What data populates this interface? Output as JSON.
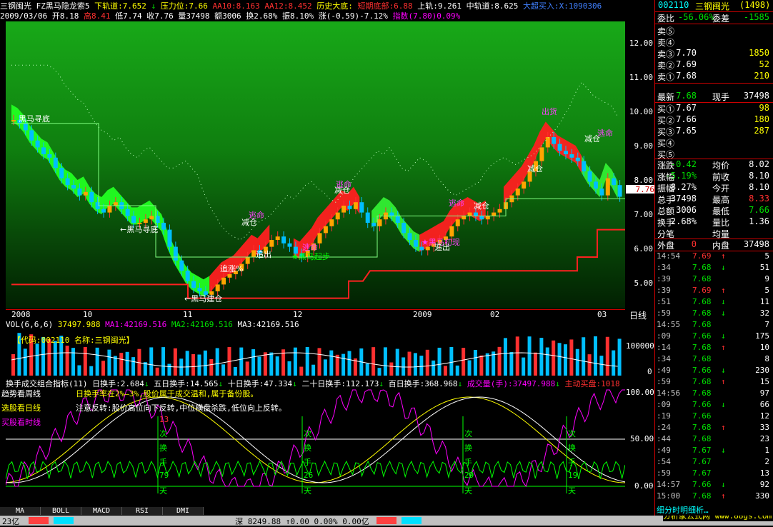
{
  "top": {
    "stock_name": "三钢闽光",
    "formula": "FZ黑马隐龙索5",
    "down_track": "下轨道:7.652",
    "pressure": "压力位:7.66",
    "aa10": "AA10:8.163",
    "aa12": "AA12:8.452",
    "history_bottom": "历史大底:",
    "short_bottom": "短期底部:6.88",
    "up_track": "上轨:9.261",
    "mid_track": "中轨道:8.625",
    "big_buy": "大超买入:X:1090306"
  },
  "info": {
    "date": "2009/03/06",
    "open": "开8.18",
    "high": "高8.41",
    "low": "低7.74",
    "close": "收7.76",
    "vol": "量37498",
    "amt": "额3006",
    "turn": "换2.68%",
    "amp": "振8.10%",
    "chg": "涨(-0.59)-7.12%",
    "index": "指数(7.80)0.09%"
  },
  "chart": {
    "price_axis": [
      "12.00",
      "11.00",
      "10.00",
      "9.00",
      "8.00",
      "7.00",
      "6.00",
      "5.00"
    ],
    "current_price": "7.76",
    "dates": [
      "2008",
      "10",
      "11",
      "12",
      "2009",
      "02",
      "03"
    ],
    "period": "日线",
    "annotations": [
      {
        "text": "黑马寻底",
        "color": "#ffffff"
      },
      {
        "text": "←黑马寻底",
        "color": "#ffffff"
      },
      {
        "text": "←黑马建仓",
        "color": "#ffffff"
      },
      {
        "text": "减仓",
        "color": "#ffffff"
      },
      {
        "text": "逃命",
        "color": "#ff40ff"
      },
      {
        "text": "减仓",
        "color": "#ffffff"
      },
      {
        "text": "逃命",
        "color": "#ff40ff"
      },
      {
        "text": "★黑马起步",
        "color": "#00ff00"
      },
      {
        "text": "追涨%",
        "color": "#ffffff"
      },
      {
        "text": "追出",
        "color": "#ffffff"
      },
      {
        "text": "逃命",
        "color": "#ff40ff"
      },
      {
        "text": "减仓",
        "color": "#ffffff"
      },
      {
        "text": "★黑马初现",
        "color": "#ff40ff"
      },
      {
        "text": "追出",
        "color": "#ffffff"
      },
      {
        "text": "逃命",
        "color": "#ff40ff"
      },
      {
        "text": "出货",
        "color": "#ff40ff"
      },
      {
        "text": "减仓",
        "color": "#ffffff"
      },
      {
        "text": "减仓",
        "color": "#ffffff"
      },
      {
        "text": "逃命",
        "color": "#ff40ff"
      }
    ]
  },
  "volume": {
    "header": "VOL(6,6,6)",
    "vol": "37497.988",
    "ma1": "MA1:42169.516",
    "ma2": "MA2:42169.516",
    "ma3": "MA3:42169.516",
    "code_label": "【代码:002110  名称:三钢闽光】",
    "axis": [
      "100000",
      "0"
    ]
  },
  "indicator": {
    "name": "换手成交组合指标(11)",
    "d1": "日换手:2.684",
    "d5": "五日换手:14.565",
    "d10": "十日换手:47.334",
    "d20": "二十日换手:112.173",
    "d100": "百日换手:368.968",
    "volh": "成交量(手):37497.988",
    "buy": "主动买盘:1018",
    "line1": "趋势看周线",
    "line2": "选股看日线",
    "line3": "买股看时线",
    "note1": "日换手率在2%–3%,股价属于成交温和,属于备份股。",
    "note2": "注意反转:股价高位向下反转,中位横盘杀跌,低位向上反转。",
    "axis": [
      "100.00",
      "50.00",
      "0.00"
    ],
    "vtexts": [
      {
        "num": "13",
        "chars": [
          "次",
          "换",
          "手",
          "79",
          "天"
        ]
      },
      {
        "num": "",
        "chars": [
          "次",
          "换",
          "手",
          "26",
          "天"
        ]
      },
      {
        "num": "",
        "chars": [
          "次",
          "换",
          "手",
          "29",
          "天"
        ]
      },
      {
        "num": "",
        "chars": [
          "次",
          "换",
          "手",
          "19",
          "天"
        ]
      }
    ]
  },
  "tabs": [
    "MA",
    "BOLL",
    "MACD",
    "RSI",
    "DMI"
  ],
  "status": {
    "left": "23亿",
    "mid": "深 8249.88 ↑0.00 0.00% 0.00亿",
    "brand": "分析家公式网 www.88gs.com"
  },
  "side": {
    "code": "002110",
    "name": "三钢闽光",
    "num": "(1498)",
    "weibi_label": "委比",
    "weibi": "-56.06%",
    "weicha_label": "委差",
    "weicha": "-1585",
    "sells": [
      {
        "label": "卖⑤",
        "price": "",
        "qty": ""
      },
      {
        "label": "卖④",
        "price": "",
        "qty": ""
      },
      {
        "label": "卖③",
        "price": "7.70",
        "qty": "1850"
      },
      {
        "label": "卖②",
        "price": "7.69",
        "qty": "52"
      },
      {
        "label": "卖①",
        "price": "7.68",
        "qty": "210"
      }
    ],
    "latest_label": "最新",
    "latest": "7.68",
    "xianshou_label": "现手",
    "xianshou": "37498",
    "buys": [
      {
        "label": "买①",
        "price": "7.67",
        "qty": "98"
      },
      {
        "label": "买②",
        "price": "7.66",
        "qty": "180"
      },
      {
        "label": "买③",
        "price": "7.65",
        "qty": "287"
      },
      {
        "label": "买④",
        "price": "",
        "qty": ""
      },
      {
        "label": "买⑤",
        "price": "",
        "qty": ""
      }
    ],
    "stats": [
      {
        "l1": "涨跌",
        "v1": "-0.42",
        "c1": "green",
        "l2": "均价",
        "v2": "8.02",
        "c2": "white"
      },
      {
        "l1": "涨幅",
        "v1": "-5.19%",
        "c1": "green",
        "l2": "前收",
        "v2": "8.10",
        "c2": "white"
      },
      {
        "l1": "振幅",
        "v1": "8.27%",
        "c1": "white",
        "l2": "今开",
        "v2": "8.10",
        "c2": "white"
      },
      {
        "l1": "总手",
        "v1": "37498",
        "c1": "white",
        "l2": "最高",
        "v2": "8.33",
        "c2": "red"
      },
      {
        "l1": "总额",
        "v1": "3006",
        "c1": "white",
        "l2": "最低",
        "v2": "7.66",
        "c2": "green"
      },
      {
        "l1": "换手",
        "v1": "2.68%",
        "c1": "white",
        "l2": "量比",
        "v2": "1.36",
        "c2": "white"
      },
      {
        "l1": "分笔",
        "v1": "",
        "c1": "white",
        "l2": "均量",
        "v2": "",
        "c2": "white"
      }
    ],
    "wp_label": "外盘",
    "wp": "0",
    "np_label": "内盘",
    "np": "37498",
    "ticks": [
      {
        "t": "14:54",
        "p": "7.69",
        "a": "↑",
        "q": "5",
        "pc": "red",
        "ac": "red",
        "qc": "white"
      },
      {
        "t": ":34",
        "p": "7.68",
        "a": "↓",
        "q": "51",
        "pc": "green",
        "ac": "green",
        "qc": "white"
      },
      {
        "t": ":39",
        "p": "7.68",
        "a": "",
        "q": "9",
        "pc": "green",
        "ac": "green",
        "qc": "white"
      },
      {
        "t": ":39",
        "p": "7.69",
        "a": "↑",
        "q": "5",
        "pc": "red",
        "ac": "red",
        "qc": "white"
      },
      {
        "t": ":51",
        "p": "7.68",
        "a": "↓",
        "q": "11",
        "pc": "green",
        "ac": "green",
        "qc": "white"
      },
      {
        "t": ":59",
        "p": "7.68",
        "a": "↓",
        "q": "32",
        "pc": "green",
        "ac": "green",
        "qc": "white"
      },
      {
        "t": "14:55",
        "p": "7.68",
        "a": "",
        "q": "7",
        "pc": "green",
        "ac": "green",
        "qc": "white"
      },
      {
        "t": ":09",
        "p": "7.66",
        "a": "↓",
        "q": "175",
        "pc": "green",
        "ac": "green",
        "qc": "white"
      },
      {
        "t": ":14",
        "p": "7.68",
        "a": "↑",
        "q": "10",
        "pc": "green",
        "ac": "red",
        "qc": "white"
      },
      {
        "t": ":34",
        "p": "7.68",
        "a": "",
        "q": "8",
        "pc": "green",
        "ac": "green",
        "qc": "white"
      },
      {
        "t": ":49",
        "p": "7.66",
        "a": "↓",
        "q": "230",
        "pc": "green",
        "ac": "green",
        "qc": "white"
      },
      {
        "t": ":59",
        "p": "7.68",
        "a": "↑",
        "q": "15",
        "pc": "green",
        "ac": "red",
        "qc": "white"
      },
      {
        "t": "14:56",
        "p": "7.68",
        "a": "",
        "q": "97",
        "pc": "green",
        "ac": "green",
        "qc": "white"
      },
      {
        "t": ":09",
        "p": "7.66",
        "a": "↓",
        "q": "66",
        "pc": "green",
        "ac": "green",
        "qc": "white"
      },
      {
        "t": ":19",
        "p": "7.66",
        "a": "",
        "q": "12",
        "pc": "green",
        "ac": "green",
        "qc": "white"
      },
      {
        "t": ":24",
        "p": "7.68",
        "a": "↑",
        "q": "33",
        "pc": "green",
        "ac": "red",
        "qc": "white"
      },
      {
        "t": ":44",
        "p": "7.68",
        "a": "",
        "q": "23",
        "pc": "green",
        "ac": "green",
        "qc": "white"
      },
      {
        "t": ":49",
        "p": "7.67",
        "a": "↓",
        "q": "1",
        "pc": "green",
        "ac": "green",
        "qc": "white"
      },
      {
        "t": ":54",
        "p": "7.67",
        "a": "",
        "q": "2",
        "pc": "green",
        "ac": "green",
        "qc": "white"
      },
      {
        "t": ":59",
        "p": "7.67",
        "a": "",
        "q": "13",
        "pc": "green",
        "ac": "green",
        "qc": "white"
      },
      {
        "t": "14:57",
        "p": "7.66",
        "a": "↓",
        "q": "92",
        "pc": "green",
        "ac": "green",
        "qc": "white"
      },
      {
        "t": "15:00",
        "p": "7.68",
        "a": "↑",
        "q": "330",
        "pc": "green",
        "ac": "red",
        "qc": "white"
      }
    ],
    "footer": "细分时明细析…"
  }
}
